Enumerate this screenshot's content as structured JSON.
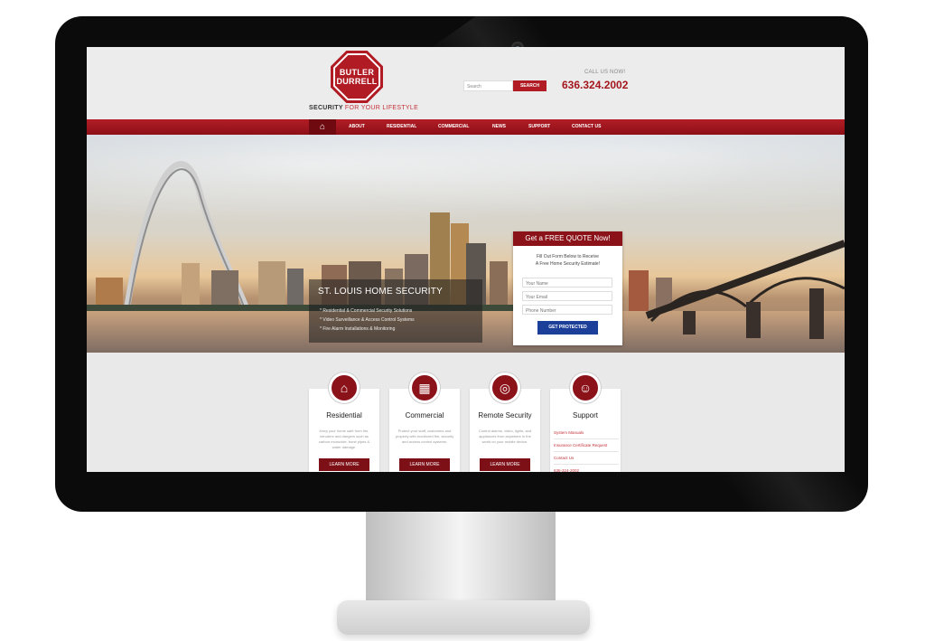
{
  "site": {
    "logo_line1": "BUTLER",
    "logo_line2": "DURRELL",
    "tagline_strong": "SECURITY",
    "tagline_rest": "FOR YOUR LIFESTYLE"
  },
  "header": {
    "search_placeholder": "Search",
    "search_button": "SEARCH",
    "call_label": "CALL US NOW!",
    "phone": "636.324.2002"
  },
  "nav": {
    "home_icon": "home-icon",
    "items": [
      "ABOUT",
      "RESIDENTIAL",
      "COMMERCIAL",
      "NEWS",
      "SUPPORT",
      "CONTACT US"
    ]
  },
  "hero": {
    "title": "ST. LOUIS HOME SECURITY",
    "bullets": [
      "* Residential & Commercial Security Solutions",
      "* Video Surveillance & Access Control Systems",
      "* Fire Alarm Installations & Monitoring"
    ]
  },
  "quote": {
    "title": "Get a FREE QUOTE Now!",
    "intro_line1": "Fill Out Form Below to Receive",
    "intro_line2": "A Free Home Security Estimate!",
    "name_placeholder": "Your Name",
    "email_placeholder": "Your Email",
    "phone_placeholder": "Phone Number",
    "submit": "GET PROTECTED"
  },
  "cards": [
    {
      "title": "Residential",
      "icon": "house-icon",
      "desc": "Keep your home safe from fire, intruders and dangers such as carbon monoxide, burst pipes & water damage.",
      "button": "LEARN MORE"
    },
    {
      "title": "Commercial",
      "icon": "building-icon",
      "desc": "Protect your staff, customers and property with monitored fire, security and access control systems.",
      "button": "LEARN MORE"
    },
    {
      "title": "Remote Security",
      "icon": "remote-icon",
      "desc": "Control alarms, video, lights, and appliances from anywhere in the world on your mobile device.",
      "button": "LEARN MORE"
    }
  ],
  "support": {
    "title": "Support",
    "icon": "headset-icon",
    "links": [
      "System Manuals",
      "Insurance Certificate Request",
      "Contact Us",
      "636-324-2002"
    ]
  },
  "colors": {
    "brand_red": "#b11c24",
    "dark_red": "#8c1219",
    "button_blue": "#1c3f9a"
  }
}
